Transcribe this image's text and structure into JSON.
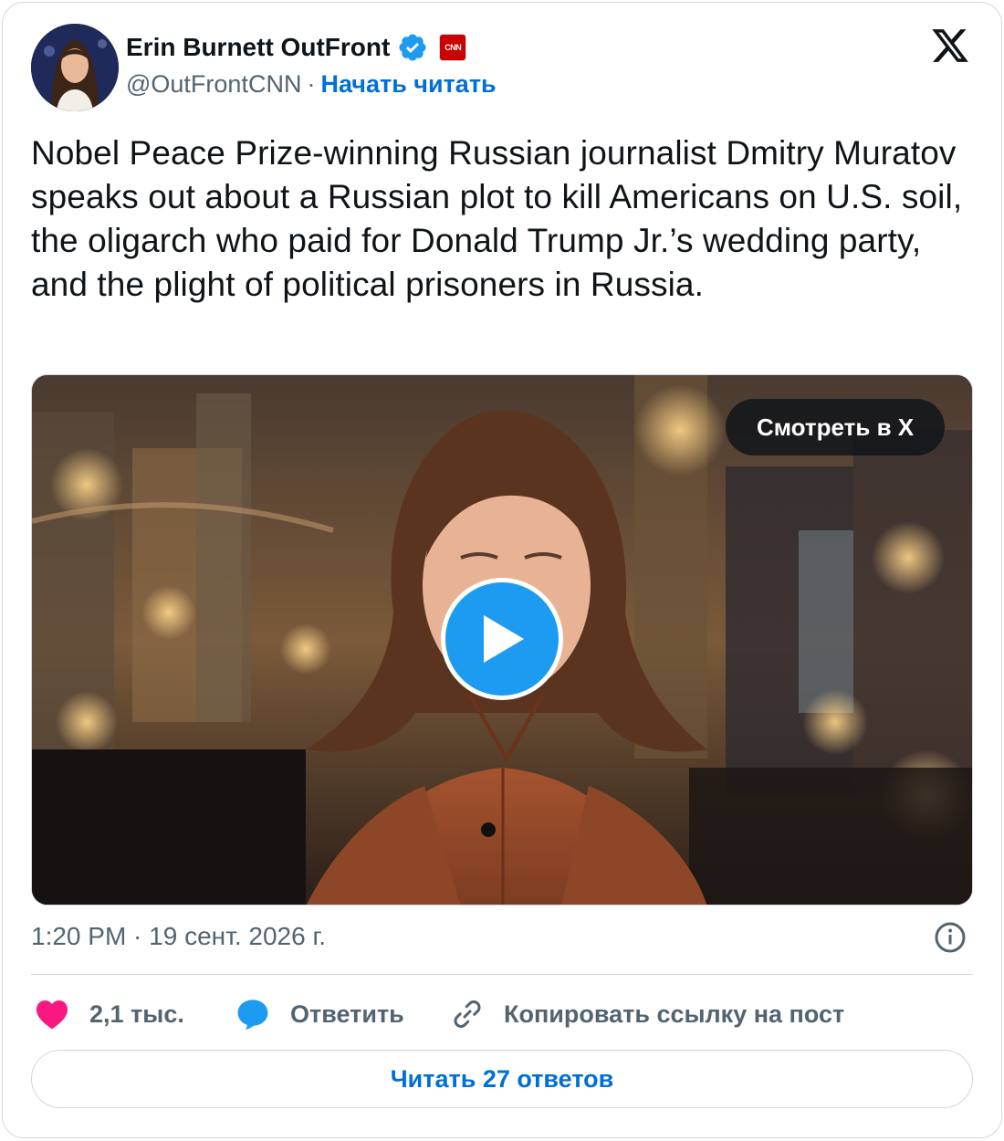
{
  "author": {
    "display_name": "Erin Burnett OutFront",
    "handle": "@OutFrontCNN",
    "separator": "·",
    "follow_label": "Начать читать",
    "affiliate_label": "CNN"
  },
  "tweet": {
    "text": "Nobel Peace Prize-winning Russian journalist Dmitry Muratov speaks out about a Russian plot to kill Americans on U.S. soil, the oligarch who paid for Donald Trump Jr.’s wedding party, and the plight of political prisoners in Russia."
  },
  "media": {
    "watch_label": "Смотреть в X"
  },
  "meta": {
    "timestamp": "1:20 PM · 19 сент. 2026 г."
  },
  "actions": {
    "like_count": "2,1 тыс.",
    "reply_label": "Ответить",
    "copy_link_label": "Копировать ссылку на пост"
  },
  "footer": {
    "read_replies_label": "Читать 27 ответов"
  },
  "colors": {
    "link": "#006fd6",
    "like": "#f91880",
    "reply": "#1d9bf0",
    "muted": "#536471",
    "border": "#cfd9de"
  },
  "icons": [
    "avatar",
    "verified-badge-icon",
    "cnn-affiliate-icon",
    "x-logo-icon",
    "play-icon",
    "info-icon",
    "heart-icon",
    "reply-bubble-icon",
    "link-icon"
  ]
}
